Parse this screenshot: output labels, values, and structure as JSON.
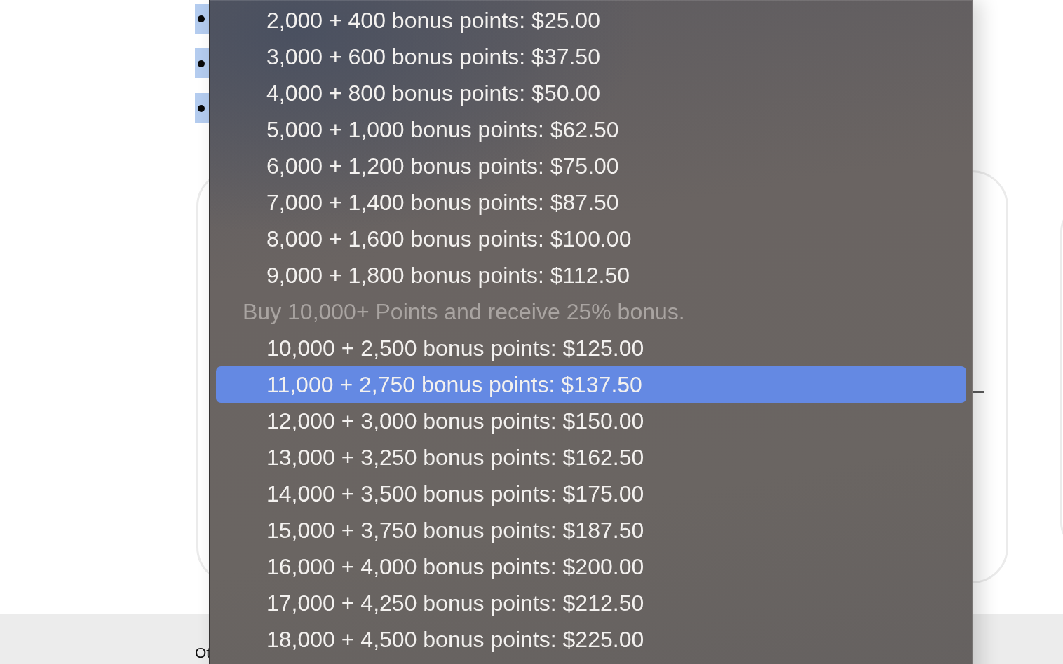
{
  "bullet_list": {
    "items": [
      {
        "selected": true
      },
      {
        "selected": true
      },
      {
        "selected": true
      }
    ]
  },
  "dropdown_menu": {
    "items": [
      {
        "kind": "option",
        "label": "2,000 + 400 bonus points: $25.00",
        "selected": false
      },
      {
        "kind": "option",
        "label": "3,000 + 600 bonus points: $37.50",
        "selected": false
      },
      {
        "kind": "option",
        "label": "4,000 + 800 bonus points: $50.00",
        "selected": false
      },
      {
        "kind": "option",
        "label": "5,000 + 1,000 bonus points: $62.50",
        "selected": false
      },
      {
        "kind": "option",
        "label": "6,000 + 1,200 bonus points: $75.00",
        "selected": false
      },
      {
        "kind": "option",
        "label": "7,000 + 1,400 bonus points: $87.50",
        "selected": false
      },
      {
        "kind": "option",
        "label": "8,000 + 1,600 bonus points: $100.00",
        "selected": false
      },
      {
        "kind": "option",
        "label": "9,000 + 1,800 bonus points: $112.50",
        "selected": false
      },
      {
        "kind": "header",
        "label": "Buy 10,000+ Points and receive 25% bonus."
      },
      {
        "kind": "option",
        "label": "10,000 + 2,500 bonus points: $125.00",
        "selected": false
      },
      {
        "kind": "option",
        "label": "11,000 + 2,750 bonus points: $137.50",
        "selected": true
      },
      {
        "kind": "option",
        "label": "12,000 + 3,000 bonus points: $150.00",
        "selected": false
      },
      {
        "kind": "option",
        "label": "13,000 + 3,250 bonus points: $162.50",
        "selected": false
      },
      {
        "kind": "option",
        "label": "14,000 + 3,500 bonus points: $175.00",
        "selected": false
      },
      {
        "kind": "option",
        "label": "15,000 + 3,750 bonus points: $187.50",
        "selected": false
      },
      {
        "kind": "option",
        "label": "16,000 + 4,000 bonus points: $200.00",
        "selected": false
      },
      {
        "kind": "option",
        "label": "17,000 + 4,250 bonus points: $212.50",
        "selected": false
      },
      {
        "kind": "option",
        "label": "18,000 + 4,500 bonus points: $225.00",
        "selected": false
      }
    ]
  },
  "footer": {
    "text": "Ot"
  }
}
